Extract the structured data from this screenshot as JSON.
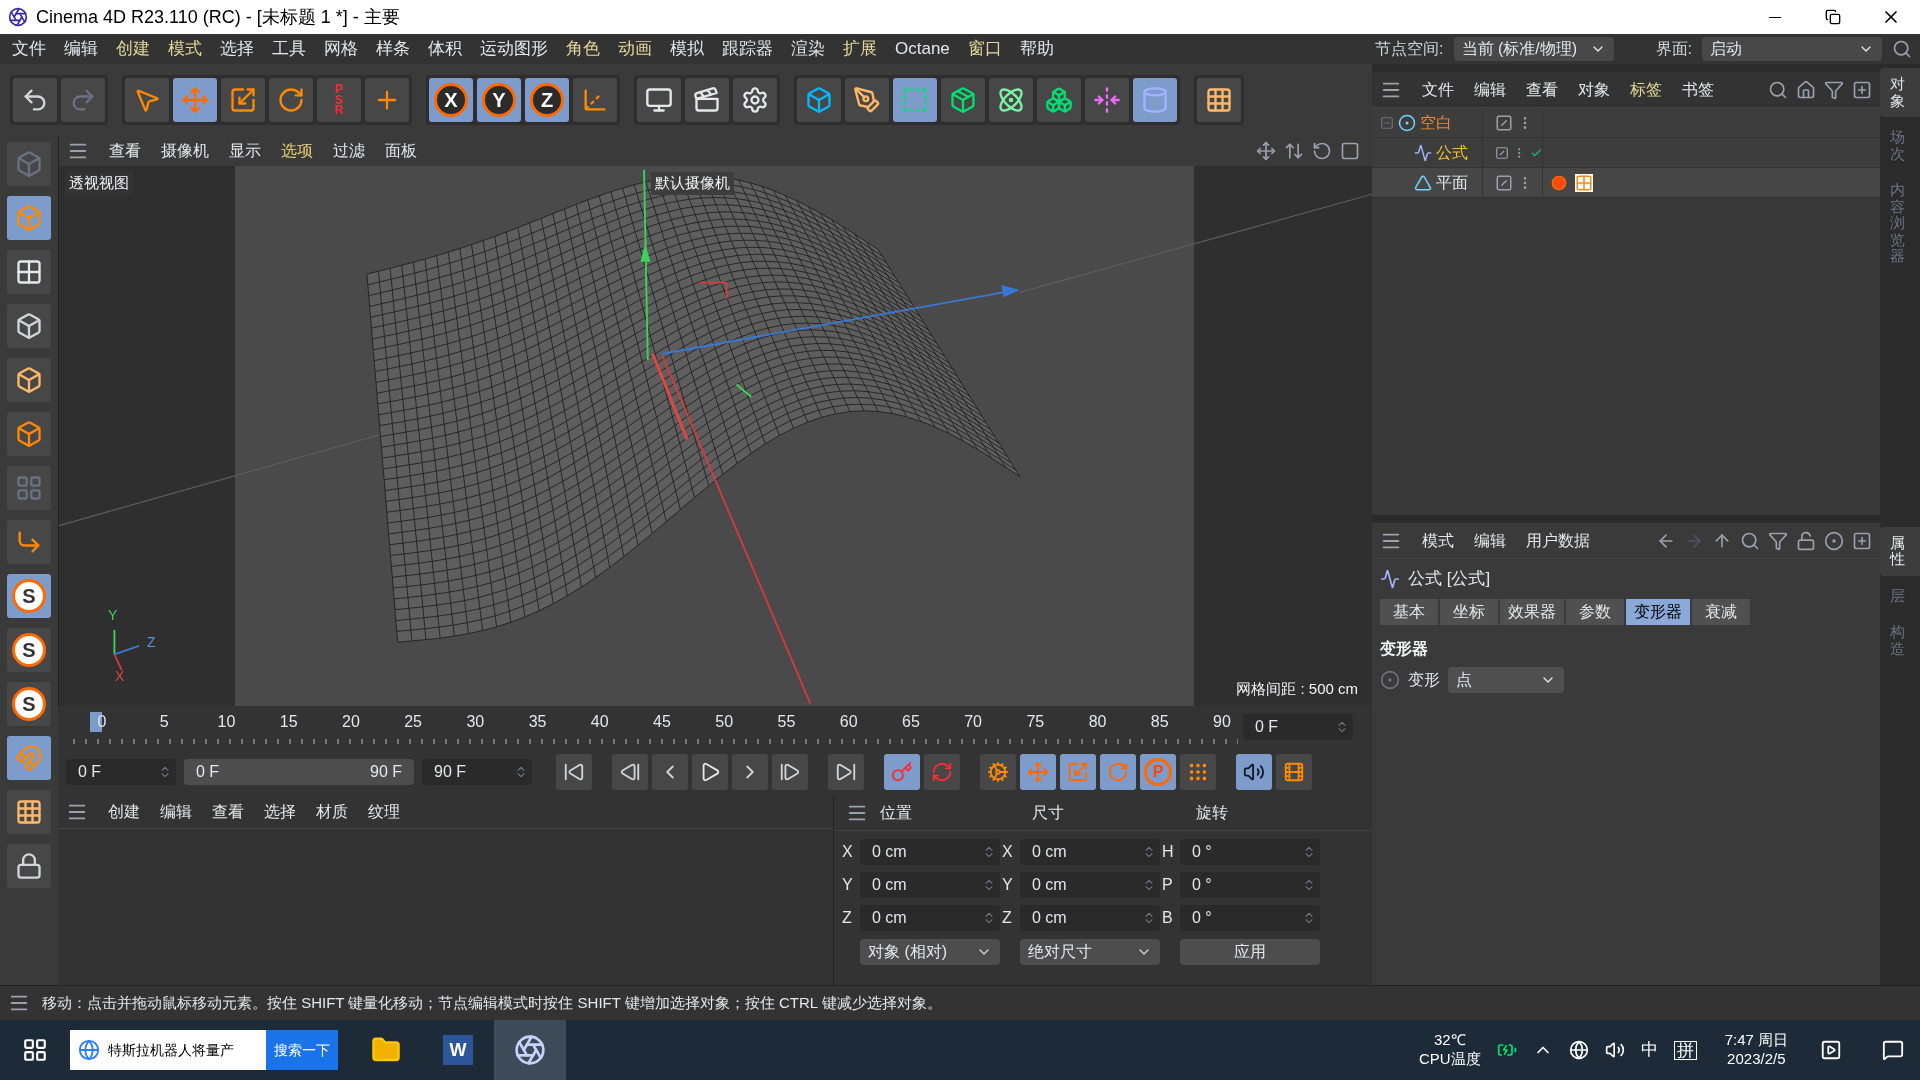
{
  "window": {
    "title": "Cinema 4D R23.110 (RC) - [未标题 1 *] - 主要"
  },
  "menu": [
    {
      "label": "文件",
      "highlighted": false
    },
    {
      "label": "编辑",
      "highlighted": false
    },
    {
      "label": "创建",
      "highlighted": true
    },
    {
      "label": "模式",
      "highlighted": true
    },
    {
      "label": "选择",
      "highlighted": false
    },
    {
      "label": "工具",
      "highlighted": false
    },
    {
      "label": "网格",
      "highlighted": false
    },
    {
      "label": "样条",
      "highlighted": false
    },
    {
      "label": "体积",
      "highlighted": false
    },
    {
      "label": "运动图形",
      "highlighted": false
    },
    {
      "label": "角色",
      "highlighted": true
    },
    {
      "label": "动画",
      "highlighted": true
    },
    {
      "label": "模拟",
      "highlighted": false
    },
    {
      "label": "跟踪器",
      "highlighted": false
    },
    {
      "label": "渲染",
      "highlighted": false
    },
    {
      "label": "扩展",
      "highlighted": true
    },
    {
      "label": "Octane",
      "highlighted": false
    },
    {
      "label": "窗口",
      "highlighted": true
    },
    {
      "label": "帮助",
      "highlighted": false
    }
  ],
  "node_space": {
    "label": "节点空间:",
    "value": "当前 (标准/物理)"
  },
  "layout": {
    "label": "界面:",
    "value": "启动"
  },
  "toolbar": [
    {
      "kind": "undo",
      "selected": false
    },
    {
      "kind": "redo",
      "selected": false
    },
    {
      "kind": "cursor",
      "selected": false
    },
    {
      "kind": "move",
      "selected": true
    },
    {
      "kind": "scale",
      "selected": false
    },
    {
      "kind": "rotate",
      "selected": false
    },
    {
      "kind": "psr",
      "label": "PSR",
      "selected": false
    },
    {
      "kind": "cross",
      "selected": false
    },
    {
      "kind": "axis",
      "label": "X",
      "selected": true
    },
    {
      "kind": "axis",
      "label": "Y",
      "selected": true
    },
    {
      "kind": "axis",
      "label": "Z",
      "selected": true
    },
    {
      "kind": "coord",
      "selected": false
    },
    {
      "kind": "render-view",
      "selected": false
    },
    {
      "kind": "render",
      "selected": false
    },
    {
      "kind": "render-settings",
      "selected": false
    },
    {
      "kind": "cube",
      "selected": false
    },
    {
      "kind": "pen",
      "selected": false
    },
    {
      "kind": "subdivide",
      "selected": true
    },
    {
      "kind": "extrude",
      "selected": false
    },
    {
      "kind": "cloner",
      "selected": false
    },
    {
      "kind": "cubes",
      "selected": false
    },
    {
      "kind": "deformer",
      "selected": false
    },
    {
      "kind": "bend",
      "selected": true
    },
    {
      "kind": "floor",
      "selected": false
    }
  ],
  "left_tools": [
    {
      "kind": "logo-cube",
      "selected": false
    },
    {
      "kind": "model",
      "selected": true
    },
    {
      "kind": "texture",
      "selected": false
    },
    {
      "kind": "points",
      "selected": false
    },
    {
      "kind": "edges",
      "selected": false
    },
    {
      "kind": "polygons",
      "selected": false
    },
    {
      "kind": "uv",
      "selected": false
    },
    {
      "kind": "axis-l",
      "selected": false
    },
    {
      "kind": "snap",
      "label": "S",
      "selected": true
    },
    {
      "kind": "snap",
      "label": "S",
      "selected": false
    },
    {
      "kind": "snap",
      "label": "S",
      "selected": false
    },
    {
      "kind": "magnet",
      "selected": true
    },
    {
      "kind": "floor",
      "selected": false
    },
    {
      "kind": "lock",
      "selected": false
    }
  ],
  "viewport": {
    "menu": [
      {
        "label": "查看",
        "selected": false
      },
      {
        "label": "摄像机",
        "selected": false
      },
      {
        "label": "显示",
        "selected": false
      },
      {
        "label": "选项",
        "selected": true
      },
      {
        "label": "过滤",
        "selected": false
      },
      {
        "label": "面板",
        "selected": false
      }
    ],
    "view_name": "透视视图",
    "camera": "默认摄像机",
    "grid_spacing": "网格间距 : 500 cm",
    "axis_labels": [
      "Y",
      "Z",
      "X"
    ]
  },
  "timeline": {
    "ticks": [
      "0",
      "5",
      "10",
      "15",
      "20",
      "25",
      "30",
      "35",
      "40",
      "45",
      "50",
      "55",
      "60",
      "65",
      "70",
      "75",
      "80",
      "85",
      "90"
    ],
    "playhead": {
      "level": 0
    },
    "current_frame": "0 F",
    "start": "0 F",
    "range_start": "0 F",
    "range_end": "90 F",
    "end": "90 F",
    "controls": [
      {
        "kind": "go-start",
        "selected": false
      },
      {
        "kind": "prev-key",
        "selected": false
      },
      {
        "kind": "prev-frame",
        "selected": false
      },
      {
        "kind": "play",
        "selected": false
      },
      {
        "kind": "next-frame",
        "selected": false
      },
      {
        "kind": "next-key",
        "selected": false
      },
      {
        "kind": "go-end",
        "selected": false
      },
      {
        "kind": "record",
        "selected": true
      },
      {
        "kind": "autokey",
        "selected": false
      },
      {
        "kind": "key-gear",
        "selected": false
      },
      {
        "kind": "key-move",
        "selected": true
      },
      {
        "kind": "key-scale",
        "selected": true
      },
      {
        "kind": "key-rotate",
        "selected": true
      },
      {
        "kind": "key-param",
        "label": "P",
        "selected": true
      },
      {
        "kind": "key-points",
        "selected": false
      },
      {
        "kind": "sound",
        "selected": true
      },
      {
        "kind": "film",
        "selected": false
      }
    ]
  },
  "materials": {
    "menu": [
      "创建",
      "编辑",
      "查看",
      "选择",
      "材质",
      "纹理"
    ]
  },
  "coordinates": {
    "columns": [
      {
        "header": "位置",
        "fields": [
          {
            "axis": "X",
            "value": "0 cm"
          },
          {
            "axis": "Y",
            "value": "0 cm"
          },
          {
            "axis": "Z",
            "value": "0 cm"
          }
        ],
        "control": {
          "kind": "dropdown",
          "label": "对象 (相对)"
        }
      },
      {
        "header": "尺寸",
        "fields": [
          {
            "axis": "X",
            "value": "0 cm"
          },
          {
            "axis": "Y",
            "value": "0 cm"
          },
          {
            "axis": "Z",
            "value": "0 cm"
          }
        ],
        "control": {
          "kind": "dropdown",
          "label": "绝对尺寸"
        }
      },
      {
        "header": "旋转",
        "fields": [
          {
            "axis": "H",
            "value": "0 °"
          },
          {
            "axis": "P",
            "value": "0 °"
          },
          {
            "axis": "B",
            "value": "0 °"
          }
        ],
        "control": {
          "kind": "button",
          "label": "应用"
        }
      }
    ]
  },
  "object_manager": {
    "menu": [
      {
        "label": "文件",
        "highlighted": false
      },
      {
        "label": "编辑",
        "highlighted": false
      },
      {
        "label": "查看",
        "highlighted": false
      },
      {
        "label": "对象",
        "highlighted": false
      },
      {
        "label": "标签",
        "highlighted": true
      },
      {
        "label": "书签",
        "highlighted": false
      }
    ],
    "objects": [
      {
        "name": "空白",
        "kind": "null",
        "selected": true,
        "expanded": true,
        "children": [
          {
            "name": "公式",
            "kind": "formula",
            "selected": false,
            "active": true,
            "enabled": true
          },
          {
            "name": "平面",
            "kind": "plane",
            "selected": false,
            "tags": true
          }
        ]
      }
    ]
  },
  "object_tabs": [
    {
      "label": "对象",
      "selected": true
    },
    {
      "label": "场次",
      "selected": false
    },
    {
      "label": "内容浏览器",
      "selected": false
    }
  ],
  "attributes": {
    "menu": [
      "模式",
      "编辑",
      "用户数据"
    ],
    "title": "公式 [公式]",
    "tabs": [
      {
        "label": "基本",
        "selected": false
      },
      {
        "label": "坐标",
        "selected": false
      },
      {
        "label": "效果器",
        "selected": false
      },
      {
        "label": "参数",
        "selected": false
      },
      {
        "label": "变形器",
        "selected": true
      },
      {
        "label": "衰减",
        "selected": false
      }
    ],
    "section": "变形器",
    "field": {
      "label": "变形",
      "value": "点"
    }
  },
  "attribute_tabs": [
    {
      "label": "属性",
      "selected": true
    },
    {
      "label": "层",
      "selected": false
    },
    {
      "label": "构造",
      "selected": false
    }
  ],
  "status_bar": "移动：点击并拖动鼠标移动元素。按住 SHIFT 键量化移动；节点编辑模式时按住 SHIFT 键增加选择对象；按住 CTRL 键减少选择对象。",
  "taskbar": {
    "search": "特斯拉机器人将量产",
    "search_button": "搜索一下",
    "apps": [
      {
        "kind": "explorer",
        "active": false
      },
      {
        "kind": "word",
        "label": "W",
        "active": false
      },
      {
        "kind": "cinema",
        "active": true
      }
    ],
    "temperature": "32℃",
    "temperature_label": "CPU温度",
    "ime": "中",
    "ime_mode": "拼",
    "time": "7:47 周日",
    "date": "2023/2/5"
  }
}
